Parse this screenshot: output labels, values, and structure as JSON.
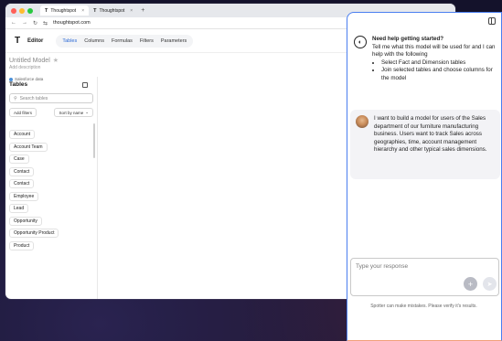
{
  "browser": {
    "tabs": [
      {
        "label": "Thoughtspot",
        "active": true
      },
      {
        "label": "Thoughtspot",
        "active": false
      }
    ],
    "url": "thoughtspot.com"
  },
  "app": {
    "title": "Editor",
    "nav": [
      "Tables",
      "Columns",
      "Formulas",
      "Filters",
      "Parameters"
    ],
    "active_nav": "Tables"
  },
  "model": {
    "name": "Untitled Model",
    "description": "Add description"
  },
  "left_panel": {
    "source": "Salesforce data",
    "title": "Tables",
    "search_placeholder": "Search tables",
    "add_filters": "Add filters",
    "sort": "Sort by name",
    "tables": [
      "Account",
      "Account Team",
      "Case",
      "Contact",
      "Contact",
      "Employee",
      "Lead",
      "Opportunity",
      "Opportunity Product",
      "Product"
    ]
  },
  "chat": {
    "bot_heading": "Need help getting started?",
    "bot_intro": "Tell me what this model will be used for and I can help with the following",
    "bot_bullets": [
      "Select Fact and Dimension tables",
      "Join selected tables and choose columns for the model"
    ],
    "user_message": "I want to build a model for users of the Sales department of our furniture manufacturing business. Users want to track Sales across geographies, time, account management hierarchy and other typical sales dimensions.",
    "input_placeholder": "Type your response",
    "disclaimer": "Spotter can make mistakes. Please verify it's results."
  },
  "colors": {
    "accent": "#2e6bd6",
    "chat_border_top": "#4a7ef0",
    "chat_border_bottom": "#f2a07b",
    "background": "#14122b"
  }
}
